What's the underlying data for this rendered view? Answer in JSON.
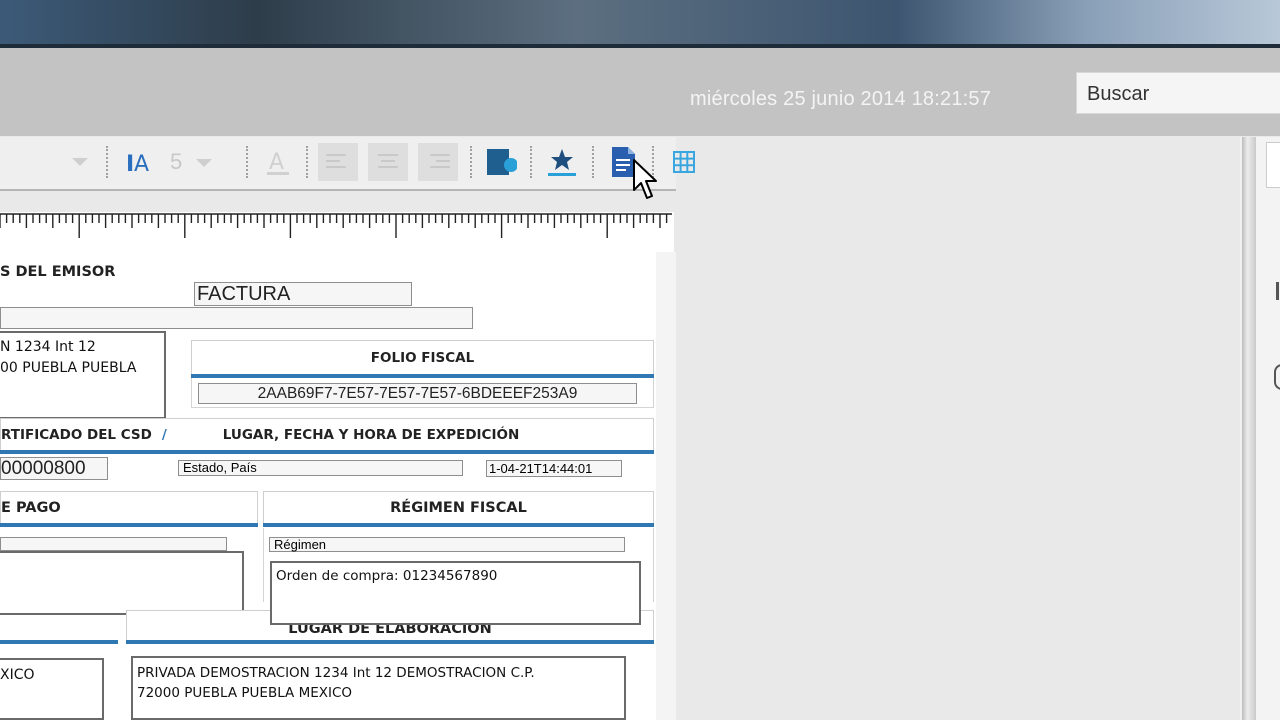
{
  "header": {
    "datetime": "miércoles 25 junio 2014 18:21:57",
    "search_placeholder": "Buscar"
  },
  "toolbar": {
    "font_size": "5",
    "icons": [
      "font-dropdown",
      "text-size-icon",
      "font-size-dropdown",
      "font-color-icon",
      "align-left-icon",
      "align-center-icon",
      "align-right-icon",
      "image-icon",
      "stamp-icon",
      "document-icon",
      "grid-icon"
    ]
  },
  "document": {
    "emisor_label": "S DEL EMISOR",
    "title": "FACTURA",
    "address_line1": "N 1234 Int 12",
    "address_line2": "00 PUEBLA PUEBLA",
    "folio_label": "FOLIO FISCAL",
    "folio_value": "2AAB69F7-7E57-7E57-7E57-6BDEEEF253A9",
    "csd_label": "RTIFICADO DEL CSD",
    "csd_slash": "/",
    "lugar_label": "LUGAR, FECHA Y HORA DE EXPEDICIÓN",
    "csd_value": "00000800",
    "estado": "Estado, País",
    "fecha": "1-04-21T14:44:01",
    "pago_label": "E PAGO",
    "regimen_label": "RÉGIMEN FISCAL",
    "regimen_value": "Régimen",
    "orden": "Orden de compra: 01234567890",
    "elaboracion_label": "LUGAR DE ELABORACIÓN",
    "elaboracion_line1": "PRIVADA DEMOSTRACION 1234 Int 12 DEMOSTRACION C.P.",
    "elaboracion_line2": "72000 PUEBLA PUEBLA MEXICO",
    "left_bottom": "XICO"
  },
  "colors": {
    "accent_blue": "#2f78b4",
    "header_gray": "#c3c3c3"
  }
}
